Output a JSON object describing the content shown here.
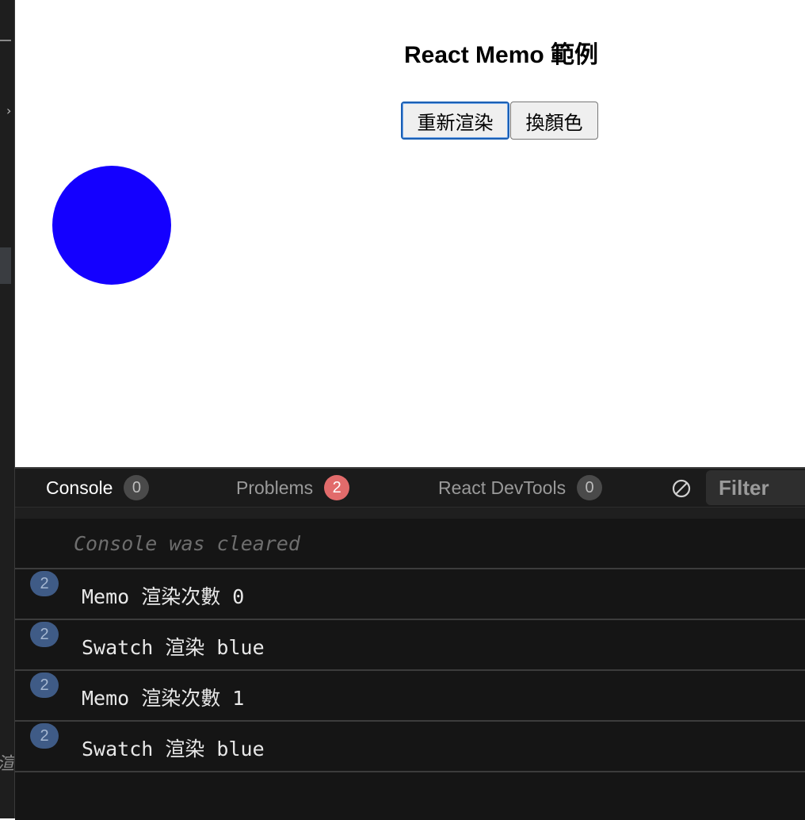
{
  "preview": {
    "title": "React Memo 範例",
    "buttons": {
      "rerender": "重新渲染",
      "change_color": "換顏色"
    },
    "swatch_color": "#1400ff"
  },
  "console": {
    "tabs": [
      {
        "label": "Console",
        "count": "0"
      },
      {
        "label": "Problems",
        "count": "2"
      },
      {
        "label": "React DevTools",
        "count": "0"
      }
    ],
    "filter_placeholder": "Filter",
    "cleared_message": "Console was cleared",
    "entries": [
      {
        "count": "2",
        "message": "Memo 渲染次數 0"
      },
      {
        "count": "2",
        "message": "Swatch 渲染 blue"
      },
      {
        "count": "2",
        "message": "Memo 渲染次數 1"
      },
      {
        "count": "2",
        "message": "Swatch 渲染 blue"
      }
    ]
  },
  "editor": {
    "fragment": "渲"
  }
}
